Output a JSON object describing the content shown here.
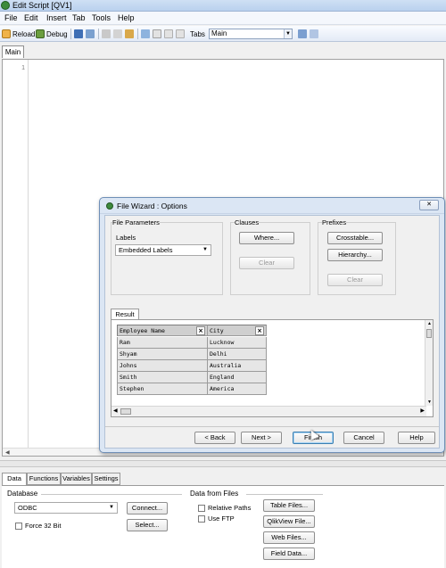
{
  "window": {
    "title": "Edit Script [QV1]"
  },
  "menu": [
    "File",
    "Edit",
    "Insert",
    "Tab",
    "Tools",
    "Help"
  ],
  "toolbar": {
    "reload_label": "Reload",
    "debug_label": "Debug",
    "tabs_label": "Tabs",
    "tabs_value": "Main"
  },
  "editor": {
    "tab_label": "Main",
    "line_number": "1"
  },
  "dialog": {
    "title": "File Wizard : Options",
    "close_label": "✕",
    "file_parameters": {
      "title": "File Parameters",
      "labels_label": "Labels",
      "labels_value": "Embedded Labels"
    },
    "clauses": {
      "title": "Clauses",
      "where_label": "Where...",
      "clear_label": "Clear"
    },
    "prefixes": {
      "title": "Prefixes",
      "crosstable_label": "Crosstable...",
      "hierarchy_label": "Hierarchy...",
      "clear_label": "Clear"
    },
    "result": {
      "tab_label": "Result",
      "columns": [
        "Employee Name",
        "City"
      ],
      "rows": [
        [
          "Ram",
          "Lucknow"
        ],
        [
          "Shyam",
          "Delhi"
        ],
        [
          "Johns",
          "Australia"
        ],
        [
          "Smith",
          "England"
        ],
        [
          "Stephen",
          "America"
        ]
      ]
    },
    "buttons": {
      "back": "< Back",
      "next": "Next >",
      "finish": "Finish",
      "cancel": "Cancel",
      "help": "Help"
    }
  },
  "bottom": {
    "tabs": [
      "Data",
      "Functions",
      "Variables",
      "Settings"
    ],
    "database": {
      "title": "Database",
      "select_value": "ODBC",
      "connect_label": "Connect...",
      "select_label": "Select...",
      "force32_label": "Force 32 Bit"
    },
    "files": {
      "title": "Data from Files",
      "relative_paths_label": "Relative Paths",
      "use_ftp_label": "Use FTP",
      "table_files_label": "Table Files...",
      "qlikview_file_label": "QlikView File...",
      "web_files_label": "Web Files...",
      "field_data_label": "Field Data..."
    }
  }
}
